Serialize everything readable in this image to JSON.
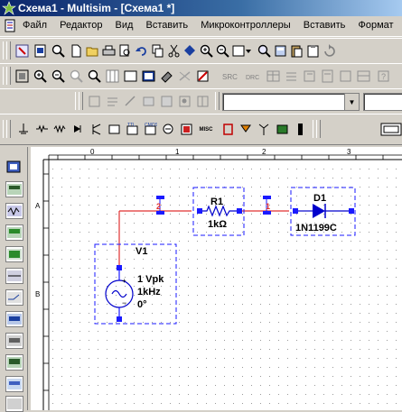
{
  "window": {
    "title": "Схема1 - Multisim - [Схема1 *]"
  },
  "menu": {
    "items": [
      {
        "label": "Файл"
      },
      {
        "label": "Редактор"
      },
      {
        "label": "Вид"
      },
      {
        "label": "Вставить"
      },
      {
        "label": "Микроконтроллеры"
      },
      {
        "label": "Вставить"
      },
      {
        "label": "Формат"
      }
    ]
  },
  "ruler": {
    "top_labels": [
      "0",
      "1",
      "2",
      "3"
    ],
    "left_labels": [
      "A",
      "B"
    ]
  },
  "schematic": {
    "components": {
      "source": {
        "refdes": "V1",
        "value_amp": "1 Vpk",
        "value_freq": "1kHz",
        "value_phase": "0°"
      },
      "resistor": {
        "refdes": "R1",
        "value": "1kΩ"
      },
      "diode": {
        "refdes": "D1",
        "model": "1N1199C"
      }
    },
    "nets": [
      {
        "label": "2"
      },
      {
        "label": "1"
      }
    ]
  },
  "toolbar4": {
    "misc_label": "MISC"
  },
  "toolbar3": {
    "combo_value": ""
  },
  "colors": {
    "wire": "#e03030",
    "node": "#1a1aff",
    "component_body": "#0000cc",
    "grid_dot": "#9a9a9a",
    "title_bar": "#0a246a"
  }
}
